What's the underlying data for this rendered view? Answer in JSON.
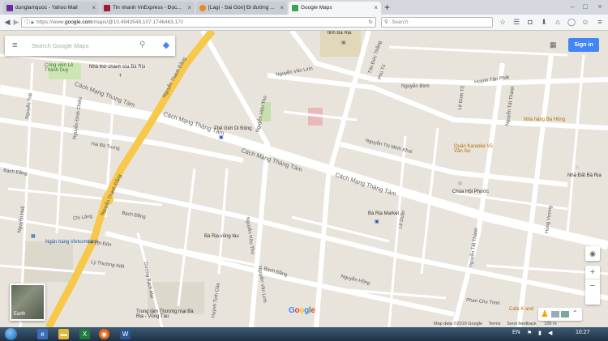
{
  "browser": {
    "tabs": [
      {
        "title": "dunglamquoc - Yahoo Mail",
        "color": "#6a2aa3"
      },
      {
        "title": "Tin nhanh VnExpress - Đọc...",
        "color": "#a01d2b"
      },
      {
        "title": "[Lagi - Sài Gòn] Đi đường ...",
        "color": "#e98a1b"
      },
      {
        "title": "Google Maps",
        "color": "#34a853"
      }
    ],
    "url_prefix": "https://www.",
    "url_domain": "google.com",
    "url_rest": "/maps/@10.4943548,107.1746463,17z",
    "search_placeholder": "Search"
  },
  "map": {
    "search_placeholder": "Search Google Maps",
    "sign_in": "Sign in",
    "earth_label": "Earth",
    "footer": {
      "mapdata": "Map data ©2016 Google",
      "terms": "Terms",
      "feedback": "Send feedback",
      "scale": "100 m"
    },
    "streets": {
      "cmt1": "Cách Mạng Tháng Tám",
      "cmt2": "Cách Mạng Tháng Tám",
      "cmt3": "Cách Mạng Tháng Tám",
      "cmt4": "Cách Mạng Tháng Tám",
      "ntd1": "Nguyễn Thanh Đằng",
      "ntd2": "Nguyễn Thanh Đằng",
      "nvl1": "Nguyễn Văn Linh",
      "nvl2": "Nguyễn Văn Linh",
      "nht1": "Nguyễn Hữu Thọ",
      "nht2": "Nguyễn Hữu Thọ",
      "ntmk": "Nguyễn Thị Minh Khai",
      "ntt1": "Nguyễn Tất Thành",
      "ntt2": "Nguyễn Tất Thành",
      "htp": "Huỳnh Tấn Phát",
      "nbinh": "Nguyễn Bính",
      "bdang1": "Bạch Đằng",
      "bdang2": "Bạch Đằng",
      "bdang3": "Bạch Đằng",
      "nhong": "Nguyễn Hồng",
      "pcht": "Phan Chu Trinh",
      "ldoan": "Lê Duẩn",
      "lldon": "Lê Lợi Đôn",
      "ltk": "Lý Thường Kiệt",
      "clang": "Chi Lăng",
      "hbtrung": "Hai Bà Trưng",
      "ptu": "Phú Tú",
      "tdthang": "Tôn Đức Thắng",
      "ndchieu": "Nguyễn Đình Chiểu",
      "dnhe": "Dương Bạch Mai",
      "ngtrai": "Nguyễn Trãi",
      "nghue": "Nguyễn Huệ",
      "ldto": "Lê Đình Tổ",
      "hung": "Hùng Vương",
      "ttrinh": "Huỳnh Tịnh Của"
    },
    "pois": {
      "tinh_ba_ria": "tỉnh Bà Rịa",
      "cong_vien": "Công viên Lê Thành Duy",
      "nha_tho": "Nhà thờ chánh tòa Bà Rịa",
      "the_gioi": "Thế Giới Di Động",
      "nha_hang": "Nhà hàng Bà Hồng",
      "quan_karaoke": "Quán Karaoke Vũ Văn Sự",
      "nha_dat": "Nhà Đất Bà Rịa",
      "chua": "Chùa Hội Phước",
      "market": "Bà Rịa Market",
      "vietcombank": "Ngân hàng Vietcombank",
      "vung_tau": "Bà Rịa vũng tàu",
      "trung_tam": "Trung tâm Thương mại Bà Rịa - Vũng Tàu",
      "cafe": "Cafe K and"
    }
  },
  "taskbar": {
    "lang": "EN",
    "time": "10:27"
  }
}
